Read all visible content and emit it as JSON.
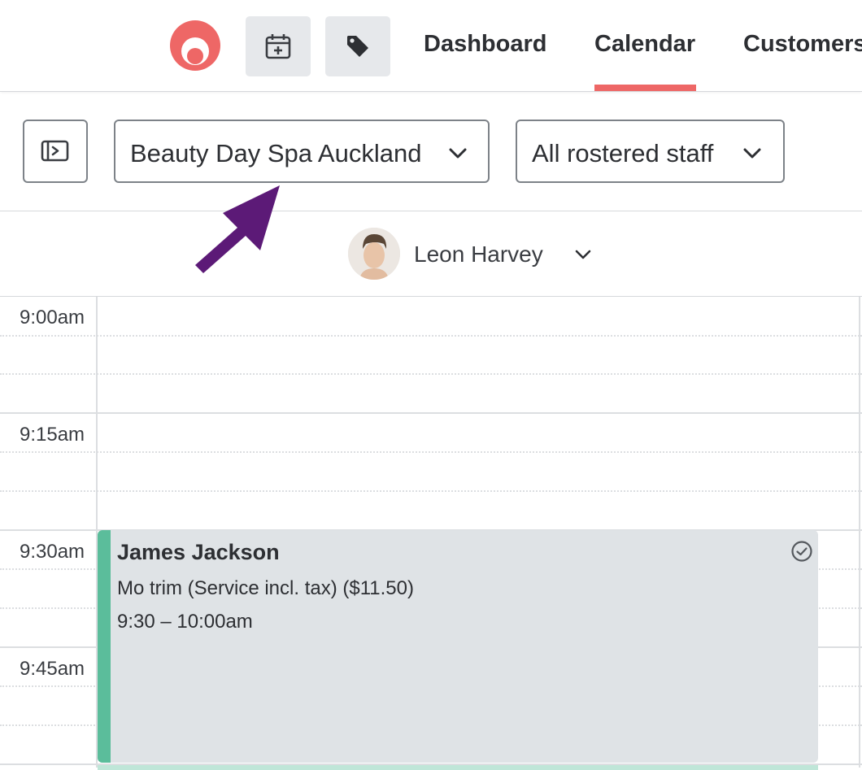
{
  "nav": {
    "links": [
      "Dashboard",
      "Calendar",
      "Customers"
    ],
    "active": "Calendar",
    "accent": "#ee6766"
  },
  "toolbar": {
    "location_select": "Beauty Day Spa Auckland",
    "staff_select": "All rostered staff"
  },
  "staff": {
    "name": "Leon Harvey"
  },
  "times": [
    "9:00am",
    "9:15am",
    "9:30am",
    "9:45am"
  ],
  "appointment": {
    "customer": "James Jackson",
    "service": "Mo trim (Service incl. tax) ($11.50)",
    "time": "9:30 – 10:00am",
    "status_color": "#5bbd9b"
  },
  "annotation_arrow_color": "#5c1a77"
}
